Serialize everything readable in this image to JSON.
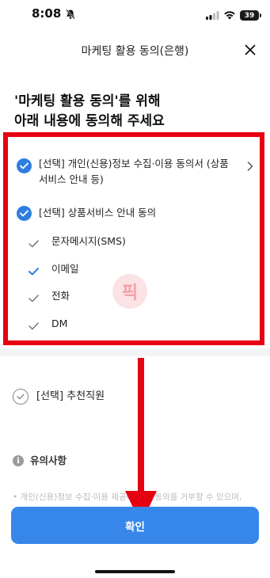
{
  "status_bar": {
    "time": "8:08",
    "battery": "39"
  },
  "header": {
    "title": "마케팅 활용 동의(은행)"
  },
  "page_title": "'마케팅 활용 동의'를 위해\n아래 내용에 동의해 주세요",
  "consent": {
    "items": [
      {
        "label": "[선택] 개인(신용)정보 수집·이용 동의서 (상품서비스 안내 등)",
        "checked": true
      },
      {
        "label": "[선택] 상품서비스 안내 동의",
        "checked": true
      }
    ],
    "channels": [
      {
        "label": "문자메시지(SMS)",
        "checked": false
      },
      {
        "label": "이메일",
        "checked": true
      },
      {
        "label": "전화",
        "checked": false
      },
      {
        "label": "DM",
        "checked": false
      }
    ]
  },
  "watermark": "픽",
  "recommend": {
    "label": "[선택] 추천직원",
    "checked": false
  },
  "notice": {
    "title": "유의사항",
    "body": "• 개인(신용)정보 수집·이용 제공에 대한 동의를 거부할 수 있으며,"
  },
  "confirm_button": {
    "label": "확인"
  },
  "colors": {
    "accent": "#3787ea",
    "highlight": "#e60012"
  }
}
